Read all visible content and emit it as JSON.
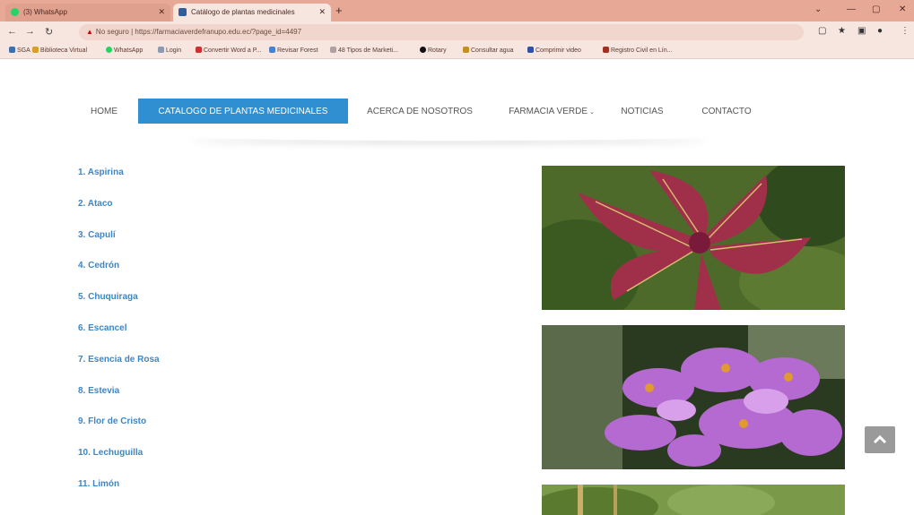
{
  "browser": {
    "tabs": [
      {
        "title": "(3) WhatsApp",
        "active": false
      },
      {
        "title": "Catálogo de plantas medicinales",
        "active": true
      }
    ],
    "address": {
      "security": "No seguro",
      "url": "https://farmaciaverdefranupo.edu.ec/?page_id=4497"
    },
    "bookmarks": [
      "SGA",
      "Biblioteca Virtual",
      "WhatsApp",
      "Login",
      "Convertir Word a P...",
      "Revisar Forest",
      "48 Tipos de Marketi...",
      "Rotary",
      "Consultar agua",
      "Comprimir video",
      "Registro Civil en Lín..."
    ]
  },
  "menu": {
    "items": [
      "HOME",
      "CATALOGO DE PLANTAS MEDICINALES",
      "ACERCA DE NOSOTROS",
      "FARMACIA VERDE",
      "NOTICIAS",
      "CONTACTO"
    ],
    "active": "CATALOGO DE PLANTAS MEDICINALES"
  },
  "plants": [
    "1. Aspirina",
    "2. Ataco",
    "3. Capulí",
    "4. Cedrón",
    "5. Chuquiraga",
    "6. Escancel",
    "7. Esencia de Rosa",
    "8. Estevia",
    "9. Flor de Cristo",
    "10. Lechuguilla",
    "11. Limón"
  ],
  "colors": {
    "accent": "#2f8fd0",
    "link": "#3d86c6",
    "tabbar": "#e8a896"
  },
  "icons": [
    "back-icon",
    "forward-icon",
    "reload-icon",
    "warning-icon",
    "chevron-up-icon",
    "close-icon"
  ]
}
